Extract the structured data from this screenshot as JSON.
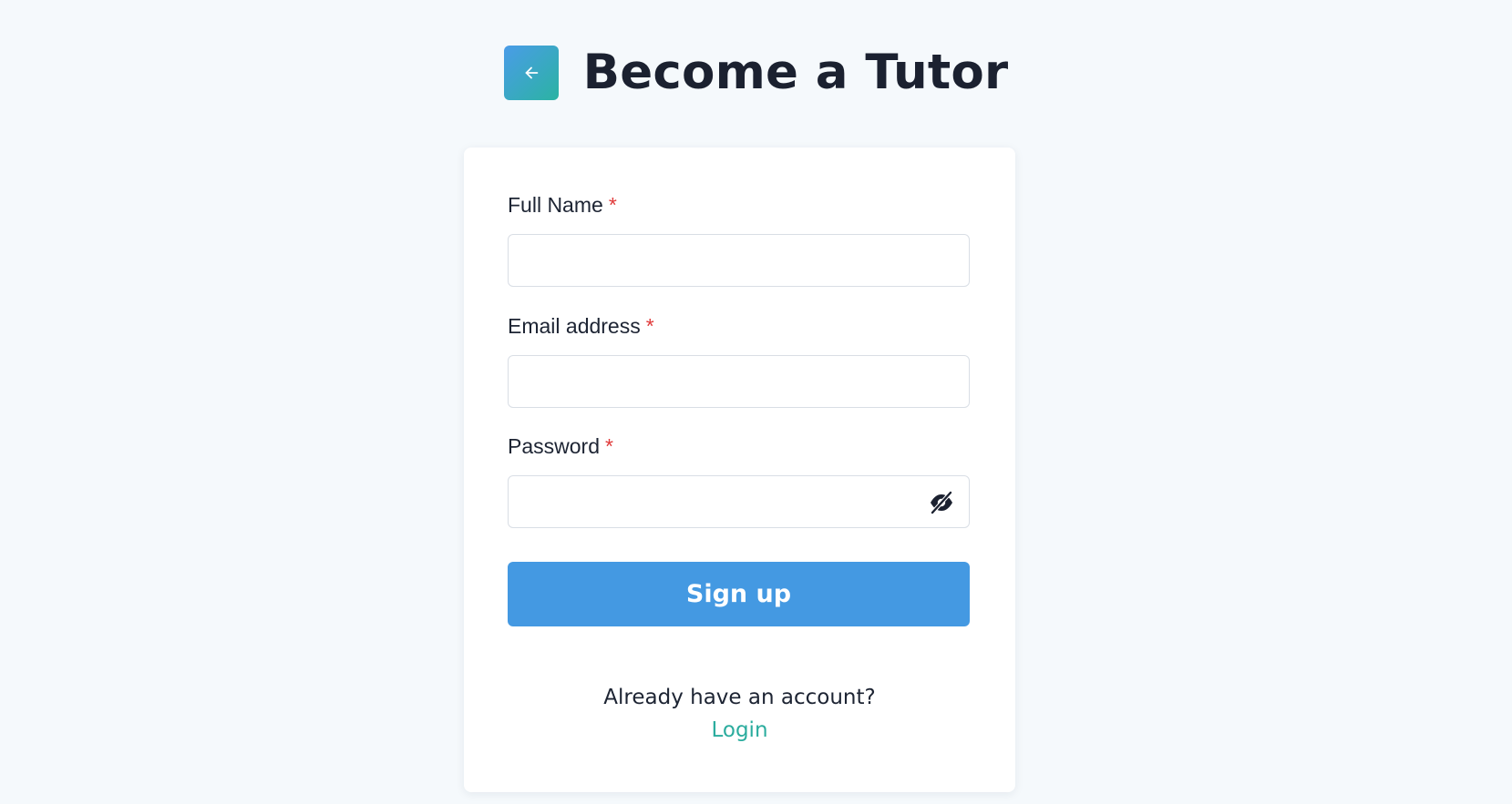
{
  "header": {
    "back_icon": "arrow-left-icon",
    "title": "Become a Tutor"
  },
  "form": {
    "full_name": {
      "label": "Full Name",
      "required_mark": "*",
      "value": "",
      "placeholder": ""
    },
    "email": {
      "label": "Email address",
      "required_mark": "*",
      "value": "",
      "placeholder": ""
    },
    "password": {
      "label": "Password",
      "required_mark": "*",
      "value": "",
      "placeholder": "",
      "toggle_icon": "eye-slash-icon"
    },
    "submit_label": "Sign up"
  },
  "footer": {
    "prompt": "Already have an account?",
    "login_label": "Login"
  },
  "colors": {
    "background": "#f5f9fc",
    "card": "#ffffff",
    "primary_button": "#4499e2",
    "link": "#2bac9e",
    "required": "#e03a3a",
    "back_button_gradient_start": "#4a9ce8",
    "back_button_gradient_end": "#2bb3a2"
  }
}
